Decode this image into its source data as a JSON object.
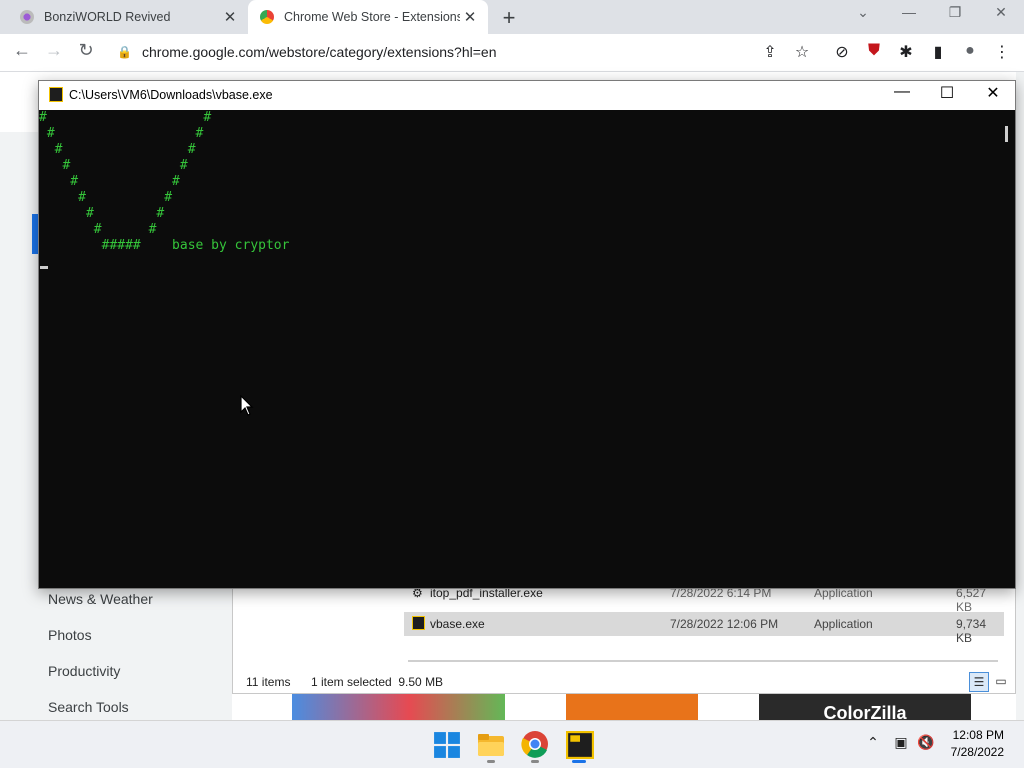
{
  "browser": {
    "tabs": [
      {
        "title": "BonziWORLD Revived",
        "close": "✕"
      },
      {
        "title": "Chrome Web Store - Extensions",
        "close": "✕"
      }
    ],
    "new_tab": "+",
    "url": "chrome.google.com/webstore/category/extensions?hl=en"
  },
  "store": {
    "categories": [
      "News & Weather",
      "Photos",
      "Productivity",
      "Search Tools"
    ],
    "banner_text": "ColorZilla"
  },
  "explorer": {
    "files": [
      {
        "name": "itop_pdf_installer.exe",
        "date": "7/28/2022 6:14 PM",
        "type": "Application",
        "size": "6,527 KB"
      },
      {
        "name": "vbase.exe",
        "date": "7/28/2022 12:06 PM",
        "type": "Application",
        "size": "9,734 KB"
      }
    ],
    "item_count": "11 items",
    "selection": "1 item selected  9.50 MB"
  },
  "console": {
    "title": "C:\\Users\\VM6\\Downloads\\vbase.exe",
    "output": "#                    #\n #                  #\n  #                #\n   #              #\n    #            #\n     #          #\n      #        #\n       #      #\n        #####    base by cryptor",
    "accent_color": "#35c43a"
  },
  "taskbar": {
    "time": "12:08 PM",
    "date": "7/28/2022",
    "icons": [
      "windows-start-icon",
      "file-explorer-icon",
      "chrome-icon",
      "vbase-console-icon"
    ]
  }
}
